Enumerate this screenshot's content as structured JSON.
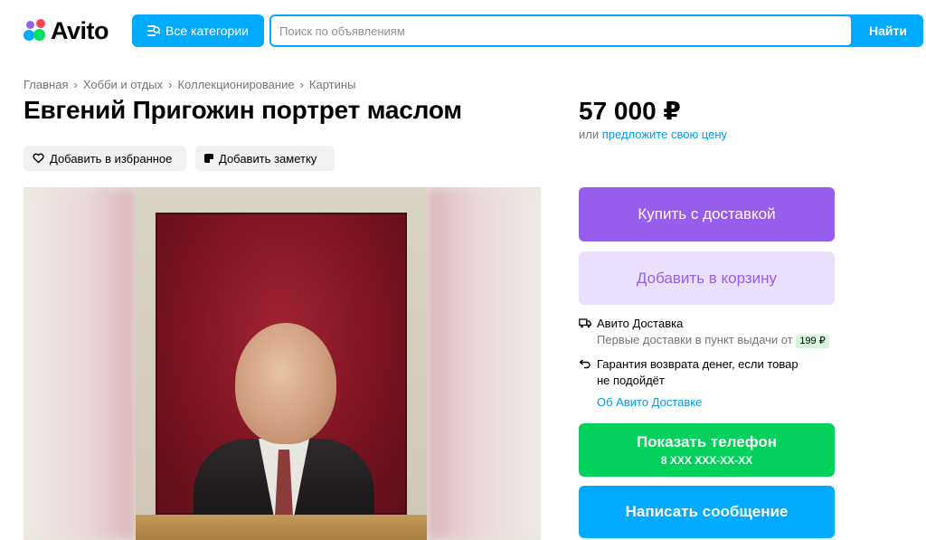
{
  "header": {
    "logo_text": "Avito",
    "categories_label": "Все категории",
    "search_placeholder": "Поиск по объявлениям",
    "search_button": "Найти"
  },
  "breadcrumbs": [
    "Главная",
    "Хобби и отдых",
    "Коллекционирование",
    "Картины"
  ],
  "listing": {
    "title": "Евгений Пригожин портрет маслом",
    "favorite_label": "Добавить в избранное",
    "note_label": "Добавить заметку"
  },
  "price": {
    "value": "57 000 ₽",
    "or_text": "или",
    "offer_link": "предложите свою цену"
  },
  "actions": {
    "buy_delivery": "Купить с доставкой",
    "add_to_cart": "Добавить в корзину",
    "show_phone": "Показать телефон",
    "phone_mask": "8 XXX XXX-XX-XX",
    "write_message": "Написать сообщение"
  },
  "delivery": {
    "title": "Авито Доставка",
    "subtitle": "Первые доставки в пункт выдачи от",
    "price_badge": "199 ₽",
    "guarantee_line1": "Гарантия возврата денег, если товар",
    "guarantee_line2": "не подойдёт",
    "about_link": "Об Авито Доставке"
  },
  "colors": {
    "accent_blue": "#00aaff",
    "purple": "#965eeb",
    "green": "#02d15c"
  }
}
